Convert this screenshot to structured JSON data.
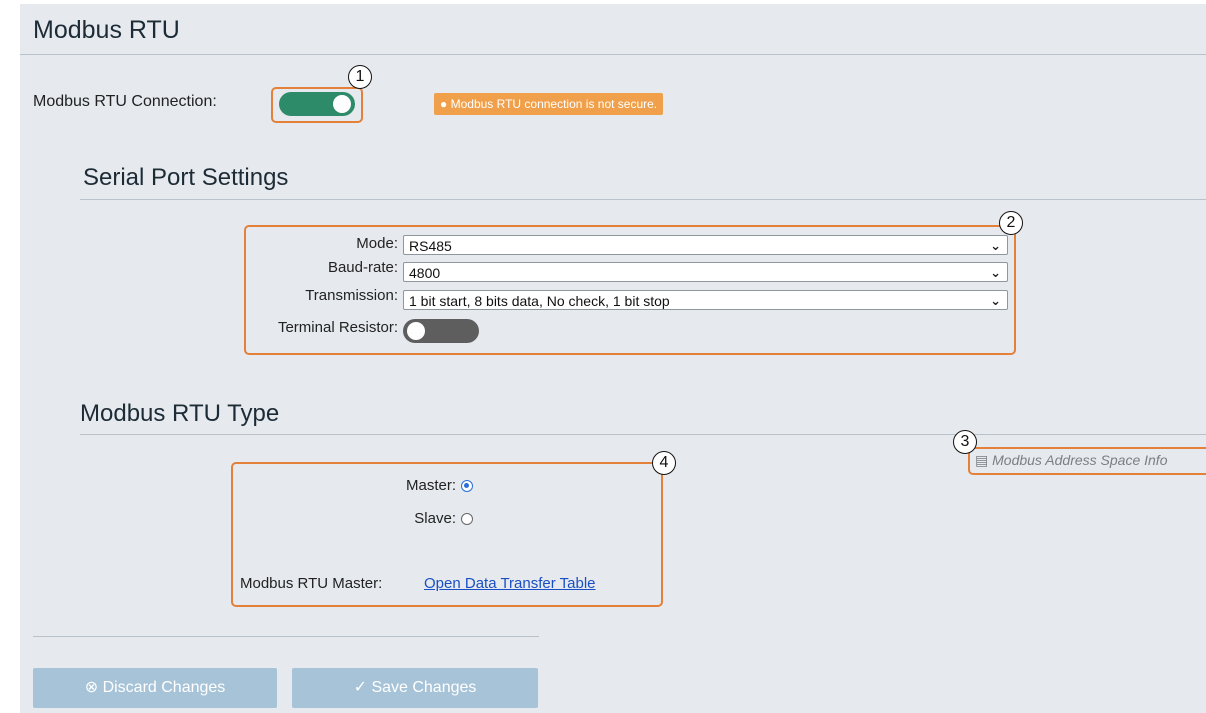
{
  "page_title": "Modbus RTU",
  "connection": {
    "label": "Modbus RTU Connection:",
    "enabled": true,
    "warning": "Modbus RTU connection is not secure.",
    "warning_icon": "info-circle-icon"
  },
  "serial": {
    "heading": "Serial Port Settings",
    "mode_label": "Mode:",
    "mode_value": "RS485",
    "baud_label": "Baud-rate:",
    "baud_value": "4800",
    "transmission_label": "Transmission:",
    "transmission_value": "1 bit start, 8 bits data, No check, 1 bit stop",
    "terminal_label": "Terminal Resistor:",
    "terminal_enabled": false
  },
  "type": {
    "heading": "Modbus RTU Type",
    "master_label": "Master:",
    "master_selected": true,
    "slave_label": "Slave:",
    "slave_selected": false,
    "rtu_master_label": "Modbus RTU Master:",
    "open_table_link": "Open Data Transfer Table",
    "address_info_link": "Modbus Address Space Info"
  },
  "buttons": {
    "discard": "Discard Changes",
    "discard_icon": "x-circle-icon",
    "save": "Save Changes",
    "save_icon": "check-circle-icon"
  },
  "callouts": [
    "1",
    "2",
    "3",
    "4"
  ],
  "colors": {
    "toggle_on": "#2e8b6a",
    "toggle_off": "#5e5e5e",
    "callout": "#e3803a",
    "warning": "#f0a04b",
    "button": "#a7c3d8",
    "link": "#1a4fc4"
  }
}
